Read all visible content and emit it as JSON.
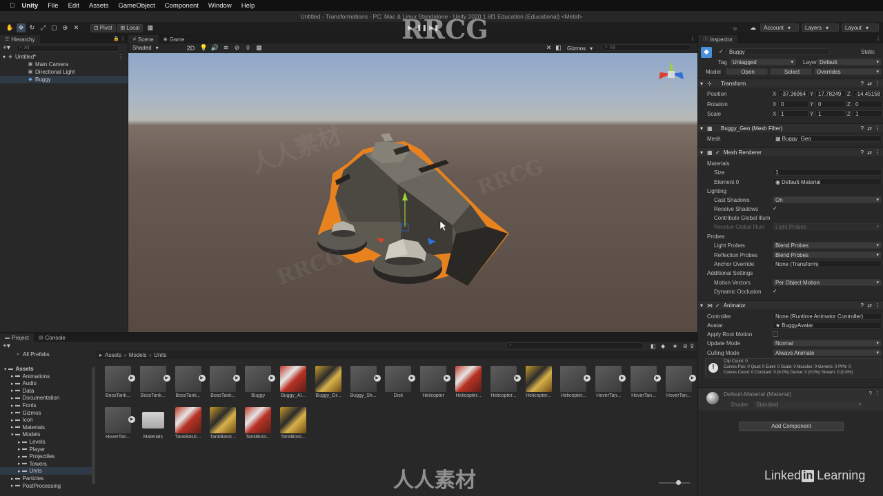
{
  "menubar": {
    "apple": "",
    "app": "Unity",
    "items": [
      "File",
      "Edit",
      "Assets",
      "GameObject",
      "Component",
      "Window",
      "Help"
    ]
  },
  "window_title": "Untitled - Transformations - PC, Mac & Linux Standalone - Unity 2020.1.6f1 Education (Educational) <Metal>",
  "toolbar": {
    "tools": [
      "hand-icon",
      "move-icon",
      "rotate-icon",
      "scale-icon",
      "rect-icon",
      "transform-icon",
      "custom-tool-icon"
    ],
    "pivot": "Pivot",
    "local": "Local",
    "account": "Account",
    "layers": "Layers",
    "layout": "Layout"
  },
  "hierarchy": {
    "tab": "Hierarchy",
    "search_placeholder": "All",
    "scene": "Untitled*",
    "items": [
      "Main Camera",
      "Directional Light",
      "Buggy"
    ],
    "selected": "Buggy"
  },
  "scene_view": {
    "tabs": [
      "Scene",
      "Game"
    ],
    "shading": "Shaded",
    "mode_2d": "2D",
    "hidden_count": "0",
    "gizmos": "Gizmos",
    "search": "All"
  },
  "project": {
    "tabs": [
      "Project",
      "Console"
    ],
    "all_prefabs": "All Prefabs",
    "folders": [
      {
        "label": "Assets",
        "depth": 0,
        "open": true
      },
      {
        "label": "Animations",
        "depth": 1
      },
      {
        "label": "Audio",
        "depth": 1
      },
      {
        "label": "Data",
        "depth": 1
      },
      {
        "label": "Documentation",
        "depth": 1
      },
      {
        "label": "Fonts",
        "depth": 1
      },
      {
        "label": "Gizmos",
        "depth": 1
      },
      {
        "label": "Icon",
        "depth": 1
      },
      {
        "label": "Materials",
        "depth": 1
      },
      {
        "label": "Models",
        "depth": 1,
        "open": true
      },
      {
        "label": "Levels",
        "depth": 2
      },
      {
        "label": "Player",
        "depth": 2
      },
      {
        "label": "Projectiles",
        "depth": 2
      },
      {
        "label": "Towers",
        "depth": 2
      },
      {
        "label": "Units",
        "depth": 2,
        "selected": true
      },
      {
        "label": "Particles",
        "depth": 1
      },
      {
        "label": "PostProcessing",
        "depth": 1
      }
    ],
    "breadcrumb": [
      "Assets",
      "Models",
      "Units"
    ],
    "hidden_count": "9",
    "assets_row1": [
      "BossTank...",
      "BossTank...",
      "BossTank...",
      "BossTank...",
      "Buggy",
      "Buggy_Al...",
      "Buggy_Or...",
      "Buggy_Sh...",
      "Disk",
      "Helicopter",
      "Helicopter...",
      "Helicopter...",
      "Helicopter...",
      "Helicopter...",
      "HoverTan...",
      "HoverTan...",
      "HoverTan..."
    ],
    "assets_row2": [
      "HoverTan...",
      "Materials",
      "TankBasic...",
      "TankBasic...",
      "TankBoss...",
      "TankBoss..."
    ]
  },
  "inspector": {
    "tab": "Inspector",
    "object_name": "Buggy",
    "static": "Static",
    "tag_label": "Tag",
    "tag": "Untagged",
    "layer_label": "Layer",
    "layer": "Default",
    "model_label": "Model",
    "open": "Open",
    "select": "Select",
    "overrides": "Overrides",
    "transform": {
      "title": "Transform",
      "position": {
        "label": "Position",
        "x": "-37.36964",
        "y": "17.78249",
        "z": "-14.45158"
      },
      "rotation": {
        "label": "Rotation",
        "x": "0",
        "y": "0",
        "z": "0"
      },
      "scale": {
        "label": "Scale",
        "x": "1",
        "y": "1",
        "z": "1"
      }
    },
    "mesh_filter": {
      "title": "Buggy_Geo (Mesh Filter)",
      "mesh_label": "Mesh",
      "mesh": "Buggy_Geo"
    },
    "mesh_renderer": {
      "title": "Mesh Renderer",
      "materials": "Materials",
      "size_label": "Size",
      "size": "1",
      "element0_label": "Element 0",
      "element0": "Default-Material",
      "lighting": "Lighting",
      "cast_shadows_label": "Cast Shadows",
      "cast_shadows": "On",
      "receive_shadows_label": "Receive Shadows",
      "contribute_gi_label": "Contribute Global Illum",
      "receive_gi_label": "Receive Global Illum",
      "receive_gi": "Light Probes",
      "probes": "Probes",
      "light_probes_label": "Light Probes",
      "light_probes": "Blend Probes",
      "reflection_probes_label": "Reflection Probes",
      "reflection_probes": "Blend Probes",
      "anchor_override_label": "Anchor Override",
      "anchor_override": "None (Transform)",
      "additional_settings": "Additional Settings",
      "motion_vectors_label": "Motion Vectors",
      "motion_vectors": "Per Object Motion",
      "dynamic_occlusion_label": "Dynamic Occlusion"
    },
    "animator": {
      "title": "Animator",
      "controller_label": "Controller",
      "controller": "None (Runtime Animator Controller)",
      "avatar_label": "Avatar",
      "avatar": "BuggyAvatar",
      "apply_root_motion_label": "Apply Root Motion",
      "update_mode_label": "Update Mode",
      "update_mode": "Normal",
      "culling_mode_label": "Culling Mode",
      "culling_mode": "Always Animate",
      "info1": "Clip Count: 0",
      "info2": "Curves Pos: 0 Quat: 0 Euler: 0 Scale: 0 Muscles: 0 Generic: 0 PPtr: 0",
      "info3": "Curves Count: 0 Constant: 0 (0.0%) Dense: 0 (0.0%) Stream: 0 (0.0%)"
    },
    "material": {
      "title": "Default-Material (Material)",
      "shader_label": "Shader",
      "shader": "Standard"
    },
    "add_component": "Add Component"
  },
  "watermarks": {
    "rrcg": "RRCG",
    "cn": "人人素材",
    "linkedin_a": "Linked",
    "linkedin_in": "in",
    "linkedin_b": "Learning"
  },
  "colors": {
    "selection": "#2f3a47",
    "sky_top": "#8aa4c8",
    "ground": "#5c4e46",
    "outline": "#e8821e"
  }
}
